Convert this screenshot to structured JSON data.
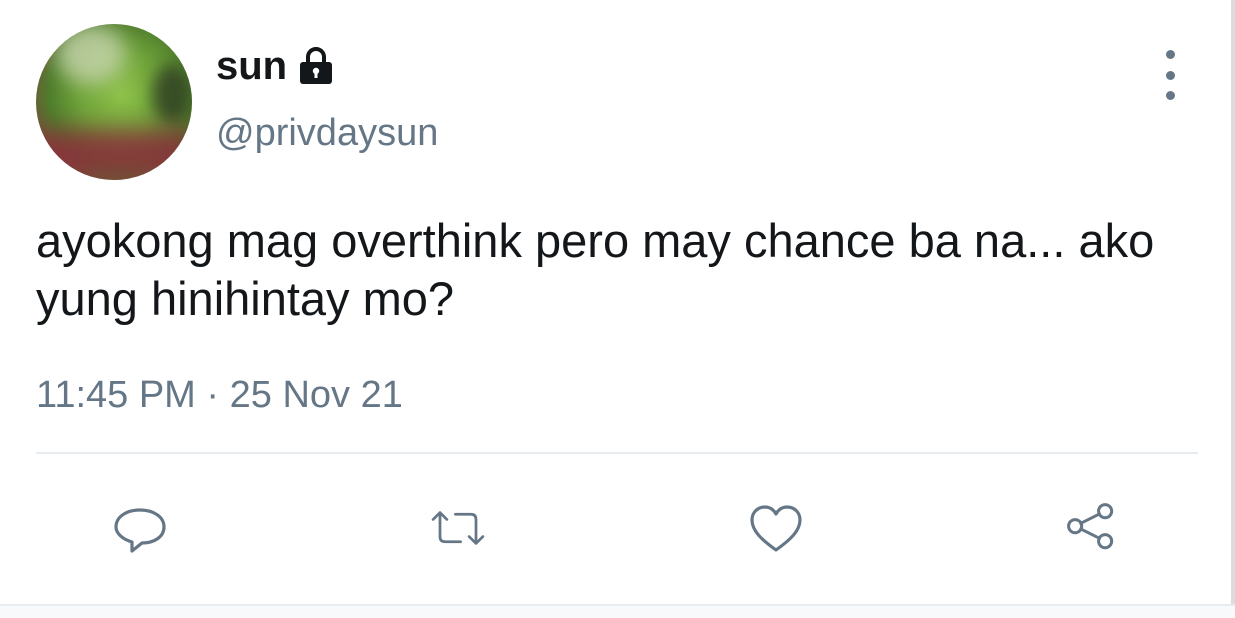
{
  "user": {
    "display_name": "sun",
    "handle": "@privdaysun",
    "protected_icon": "lock-icon",
    "avatar_icon": "avatar-image"
  },
  "tweet": {
    "text": "ayokong mag overthink pero may chance ba na... ako yung hinihintay mo?",
    "time": "11:45 PM",
    "separator": "·",
    "date": "25 Nov 21"
  },
  "actions": {
    "reply_icon": "reply-icon",
    "retweet_icon": "retweet-icon",
    "like_icon": "heart-icon",
    "share_icon": "share-icon",
    "more_icon": "more-vertical-icon"
  },
  "colors": {
    "text_primary": "#14171a",
    "text_secondary": "#657786",
    "divider": "#e6ecf0"
  }
}
